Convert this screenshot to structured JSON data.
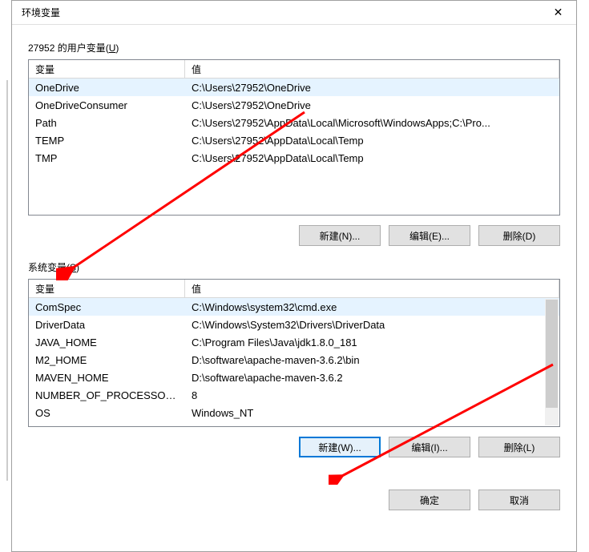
{
  "dialog": {
    "title": "环境变量",
    "close": "✕"
  },
  "userSection": {
    "label_prefix": "27952 的用户变量(",
    "label_key": "U",
    "label_suffix": ")",
    "headers": {
      "variable": "变量",
      "value": "值"
    },
    "rows": [
      {
        "name": "OneDrive",
        "value": "C:\\Users\\27952\\OneDrive",
        "selected": true
      },
      {
        "name": "OneDriveConsumer",
        "value": "C:\\Users\\27952\\OneDrive",
        "selected": false
      },
      {
        "name": "Path",
        "value": "C:\\Users\\27952\\AppData\\Local\\Microsoft\\WindowsApps;C:\\Pro...",
        "selected": false
      },
      {
        "name": "TEMP",
        "value": "C:\\Users\\27952\\AppData\\Local\\Temp",
        "selected": false
      },
      {
        "name": "TMP",
        "value": "C:\\Users\\27952\\AppData\\Local\\Temp",
        "selected": false
      }
    ],
    "buttons": {
      "new": "新建(N)...",
      "edit": "编辑(E)...",
      "delete": "删除(D)"
    }
  },
  "systemSection": {
    "label_prefix": "系统变量(",
    "label_key": "S",
    "label_suffix": ")",
    "headers": {
      "variable": "变量",
      "value": "值"
    },
    "rows": [
      {
        "name": "ComSpec",
        "value": "C:\\Windows\\system32\\cmd.exe",
        "selected": true
      },
      {
        "name": "DriverData",
        "value": "C:\\Windows\\System32\\Drivers\\DriverData",
        "selected": false
      },
      {
        "name": "JAVA_HOME",
        "value": "C:\\Program Files\\Java\\jdk1.8.0_181",
        "selected": false
      },
      {
        "name": "M2_HOME",
        "value": "D:\\software\\apache-maven-3.6.2\\bin",
        "selected": false
      },
      {
        "name": "MAVEN_HOME",
        "value": "D:\\software\\apache-maven-3.6.2",
        "selected": false
      },
      {
        "name": "NUMBER_OF_PROCESSORS",
        "value": "8",
        "selected": false
      },
      {
        "name": "OS",
        "value": "Windows_NT",
        "selected": false
      }
    ],
    "buttons": {
      "new": "新建(W)...",
      "edit": "编辑(I)...",
      "delete": "删除(L)"
    }
  },
  "dialogButtons": {
    "ok": "确定",
    "cancel": "取消"
  }
}
